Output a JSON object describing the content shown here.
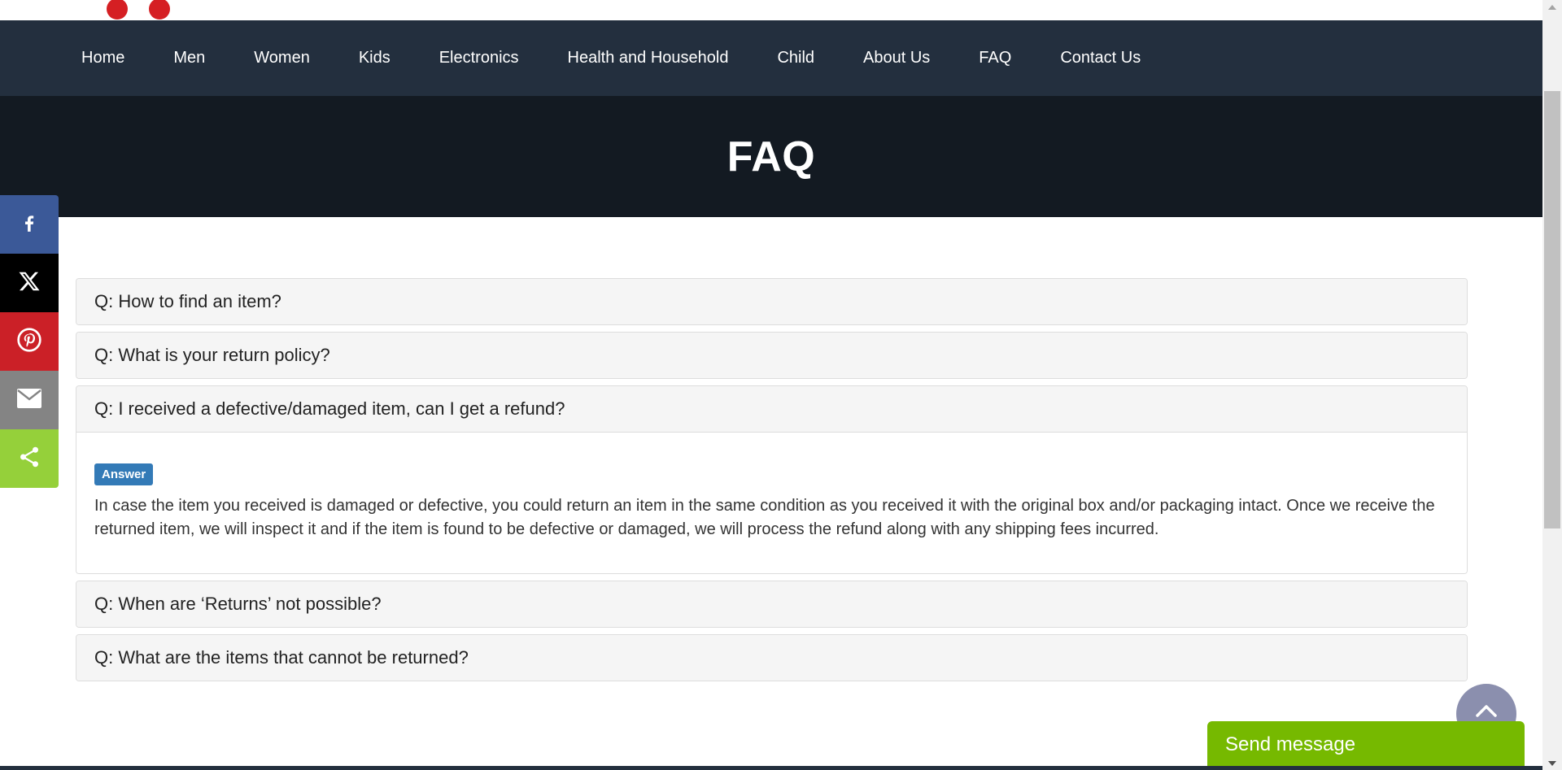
{
  "nav": {
    "items": [
      {
        "label": "Home"
      },
      {
        "label": "Men"
      },
      {
        "label": "Women"
      },
      {
        "label": "Kids"
      },
      {
        "label": "Electronics"
      },
      {
        "label": "Health and Household"
      },
      {
        "label": "Child"
      },
      {
        "label": "About Us"
      },
      {
        "label": "FAQ"
      },
      {
        "label": "Contact Us"
      }
    ]
  },
  "hero": {
    "title": "FAQ"
  },
  "faq": {
    "items": [
      {
        "question": "Q: How to find an item?",
        "expanded": false
      },
      {
        "question": "Q: What is your return policy?",
        "expanded": false
      },
      {
        "question": "Q: I received a defective/damaged item, can I get a refund?",
        "expanded": true,
        "answer_badge": "Answer",
        "answer_text": "In case the item you received is damaged or defective, you could return an item in the same condition as you received it with the original box and/or packaging intact. Once we receive the returned item, we will inspect it and if the item is found to be defective or damaged, we will process the refund along with any shipping fees incurred."
      },
      {
        "question": "Q: When are ‘Returns’ not possible?",
        "expanded": false
      },
      {
        "question": "Q: What are the items that cannot be returned?",
        "expanded": false
      }
    ]
  },
  "share": {
    "buttons": [
      {
        "icon": "facebook-icon",
        "color": "#3b5998"
      },
      {
        "icon": "x-icon",
        "color": "#000000"
      },
      {
        "icon": "pinterest-icon",
        "color": "#cb2027"
      },
      {
        "icon": "email-icon",
        "color": "#848484"
      },
      {
        "icon": "share-icon",
        "color": "#95d03a"
      }
    ]
  },
  "widgets": {
    "send_message_label": "Send message",
    "back_to_top_icon": "chevron-up-icon"
  },
  "colors": {
    "nav_bg": "#232f3e",
    "hero_bg": "#131a22",
    "answer_badge": "#337ab7",
    "send_message_bg": "#76b900",
    "top_dots": "#d51f23"
  }
}
